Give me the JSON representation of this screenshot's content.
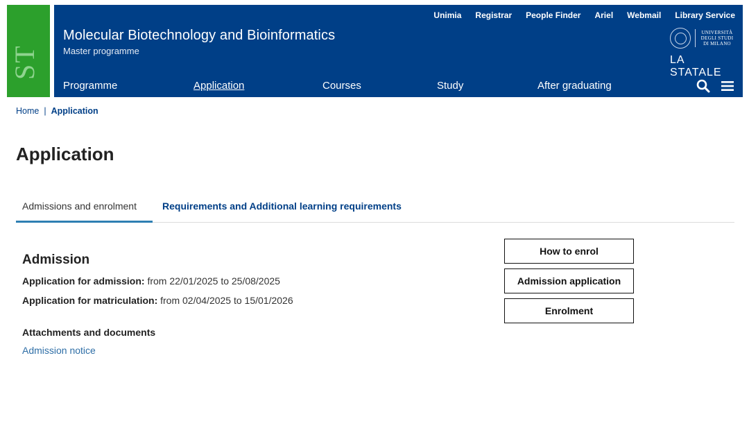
{
  "header": {
    "logo_letters": "ST",
    "site_title": "Molecular Biotechnology and Bioinformatics",
    "site_subtitle": "Master programme",
    "top_links": [
      "Unimia",
      "Registrar",
      "People Finder",
      "Ariel",
      "Webmail",
      "Library Service"
    ],
    "university_logo": {
      "line1": "UNIVERSITÀ",
      "line2": "DEGLI STUDI",
      "line3": "DI MILANO",
      "wordmark": "LA STATALE"
    },
    "main_nav": [
      "Programme",
      "Application",
      "Courses",
      "Study",
      "After graduating"
    ],
    "active_nav": "Application",
    "icons": [
      "search-icon",
      "menu-icon"
    ]
  },
  "breadcrumb": {
    "home": "Home",
    "separator": "|",
    "current": "Application"
  },
  "page_title": "Application",
  "tabs": [
    {
      "label": "Admissions and enrolment",
      "active": true
    },
    {
      "label": "Requirements and Additional learning requirements",
      "active": false
    }
  ],
  "admission": {
    "title": "Admission",
    "lines": [
      {
        "label": "Application for admission:",
        "value": " from 22/01/2025 to 25/08/2025"
      },
      {
        "label": "Application for matriculation:",
        "value": " from 02/04/2025 to 15/01/2026"
      }
    ],
    "attachments_title": "Attachments and documents",
    "attachment_link": "Admission notice"
  },
  "side_buttons": [
    "How to enrol",
    "Admission application",
    "Enrolment"
  ],
  "colors": {
    "header_blue": "#003f87",
    "logo_green": "#2ca02c",
    "link_blue": "#2e6ea6",
    "tab_underline": "#2e7fb3"
  }
}
